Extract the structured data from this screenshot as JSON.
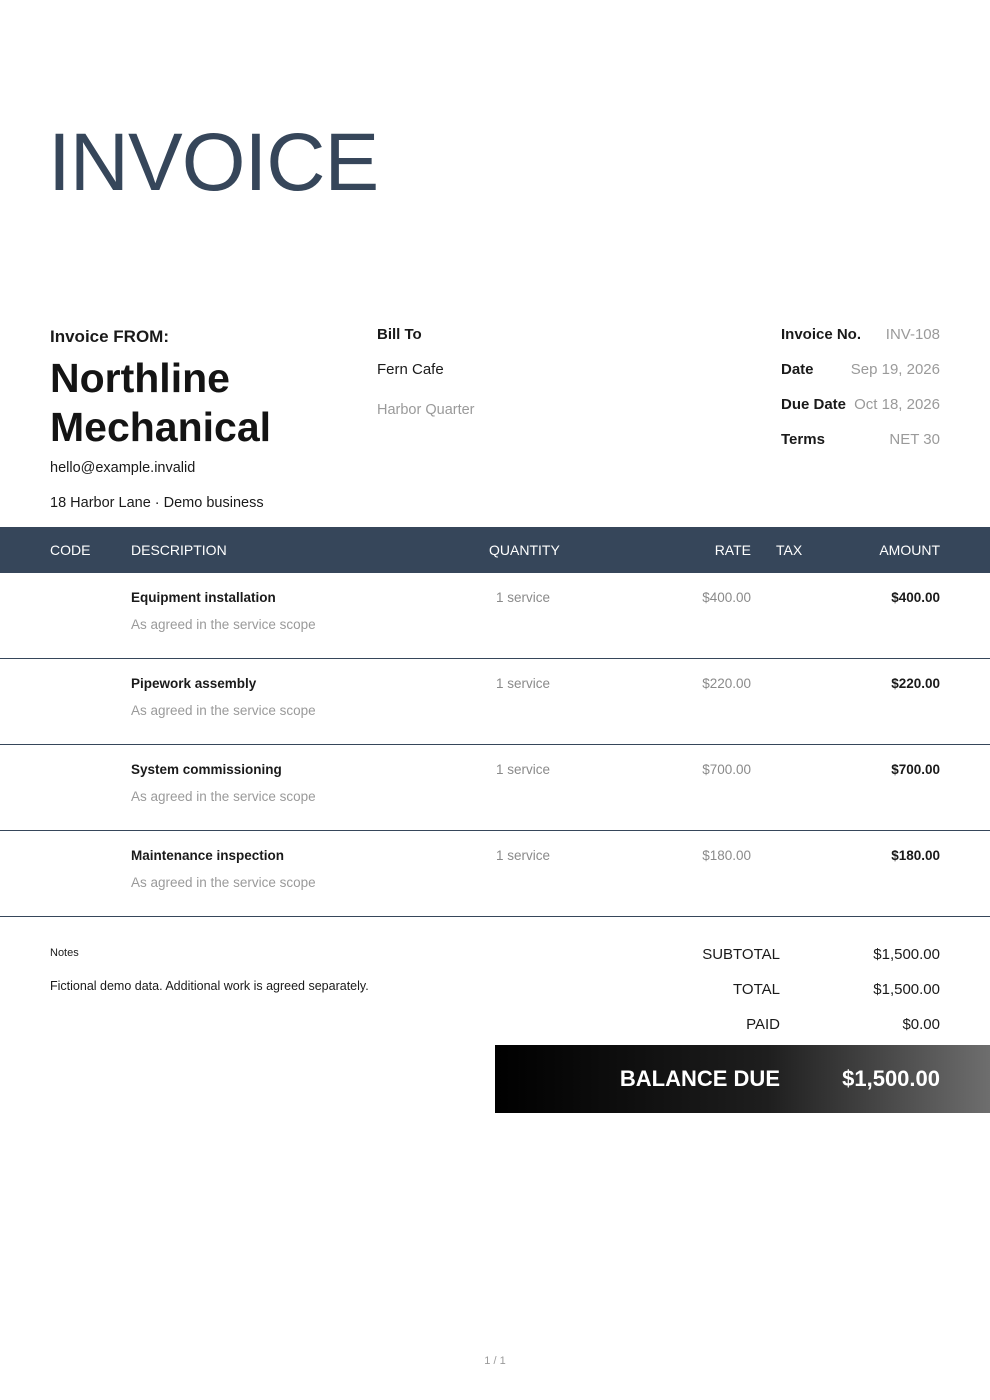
{
  "document": {
    "title": "INVOICE",
    "page_number": "1 / 1"
  },
  "from": {
    "label": "Invoice FROM:",
    "company": "Northline Mechanical",
    "email": "hello@example.invalid",
    "address": "18 Harbor Lane · Demo business"
  },
  "bill_to": {
    "label": "Bill To",
    "name": "Fern Cafe",
    "area": "Harbor Quarter"
  },
  "meta": {
    "invoice_no_label": "Invoice No.",
    "invoice_no": "INV-108",
    "date_label": "Date",
    "date": "Sep 19, 2026",
    "due_date_label": "Due Date",
    "due_date": "Oct 18, 2026",
    "terms_label": "Terms",
    "terms": "NET 30"
  },
  "table": {
    "headers": {
      "code": "CODE",
      "description": "DESCRIPTION",
      "quantity": "QUANTITY",
      "rate": "RATE",
      "tax": "TAX",
      "amount": "AMOUNT"
    },
    "rows": [
      {
        "name": "Equipment installation",
        "description": "As agreed in the service scope",
        "quantity": "1 service",
        "rate": "$400.00",
        "amount": "$400.00"
      },
      {
        "name": "Pipework assembly",
        "description": "As agreed in the service scope",
        "quantity": "1 service",
        "rate": "$220.00",
        "amount": "$220.00"
      },
      {
        "name": "System commissioning",
        "description": "As agreed in the service scope",
        "quantity": "1 service",
        "rate": "$700.00",
        "amount": "$700.00"
      },
      {
        "name": "Maintenance inspection",
        "description": "As agreed in the service scope",
        "quantity": "1 service",
        "rate": "$180.00",
        "amount": "$180.00"
      }
    ]
  },
  "notes": {
    "label": "Notes",
    "text": "Fictional demo data. Additional work is agreed separately."
  },
  "totals": {
    "subtotal_label": "SUBTOTAL",
    "subtotal": "$1,500.00",
    "total_label": "TOTAL",
    "total": "$1,500.00",
    "paid_label": "PAID",
    "paid": "$0.00",
    "balance_label": "BALANCE DUE",
    "balance": "$1,500.00"
  },
  "colors": {
    "header_bg": "#36465a",
    "title": "#36465a",
    "muted_text": "#9a9a9a"
  }
}
